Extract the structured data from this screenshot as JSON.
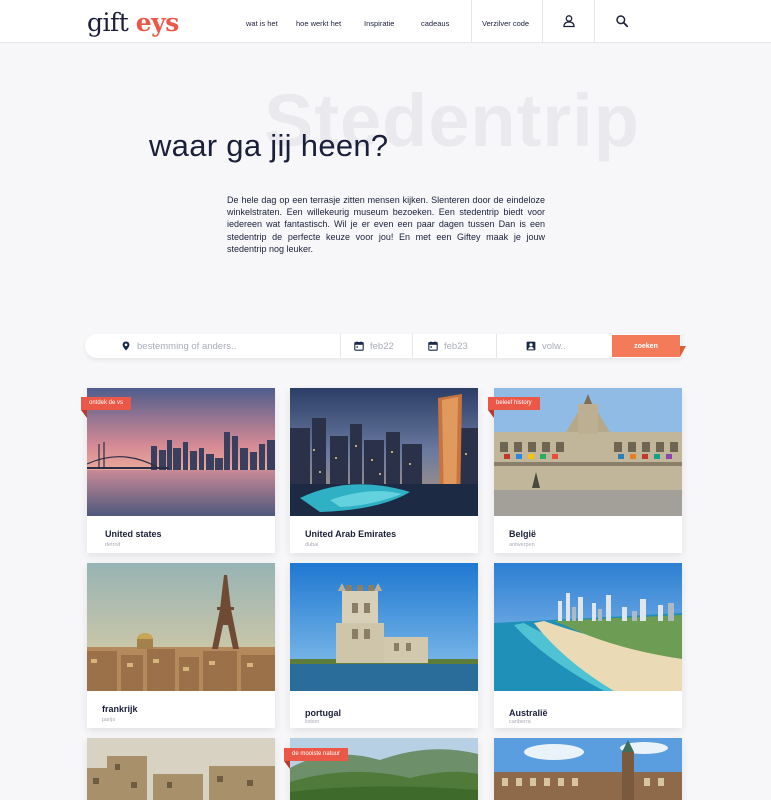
{
  "header": {
    "logo_part1": "gift",
    "logo_part2": "eys",
    "nav": [
      "wat is het",
      "hoe werkt het",
      "Inspiratie",
      "cadeaus"
    ],
    "redeem": "Verzilver code",
    "icons": [
      "user-icon",
      "search-icon"
    ]
  },
  "hero": {
    "background_word": "Stedentrip",
    "title": "waar ga jij heen?",
    "text": "De hele dag op een terrasje zitten mensen kijken. Slenteren door de eindeloze winkelstraten. Een willekeurig museum bezoeken. Een stedentrip biedt voor iedereen wat fantastisch. Wil je er even een paar dagen tussen Dan is een stedentrip de perfecte keuze voor jou! En met een Giftey maak je jouw stedentrip nog leuker."
  },
  "search": {
    "destination_placeholder": "bestemming of anders..",
    "date_from": "feb22",
    "date_to": "feb23",
    "guests": "volw..",
    "button": "zoeken"
  },
  "colors": {
    "accent": "#ec5848",
    "button": "#f47b5a",
    "text": "#1a1f3a"
  },
  "cards": [
    {
      "name": "United states",
      "sub": "detroit",
      "tag": "ontdek de vs"
    },
    {
      "name": "United Arab Emirates",
      "sub": "dubai"
    },
    {
      "name": "België",
      "sub": "antwerpen",
      "tag": "beleef history"
    },
    {
      "name": "frankrijk",
      "sub": "parijs"
    },
    {
      "name": "portugal",
      "sub": "lisbon"
    },
    {
      "name": "Australië",
      "sub": "canberra"
    },
    {
      "tag": "de mooiste natuur"
    }
  ]
}
